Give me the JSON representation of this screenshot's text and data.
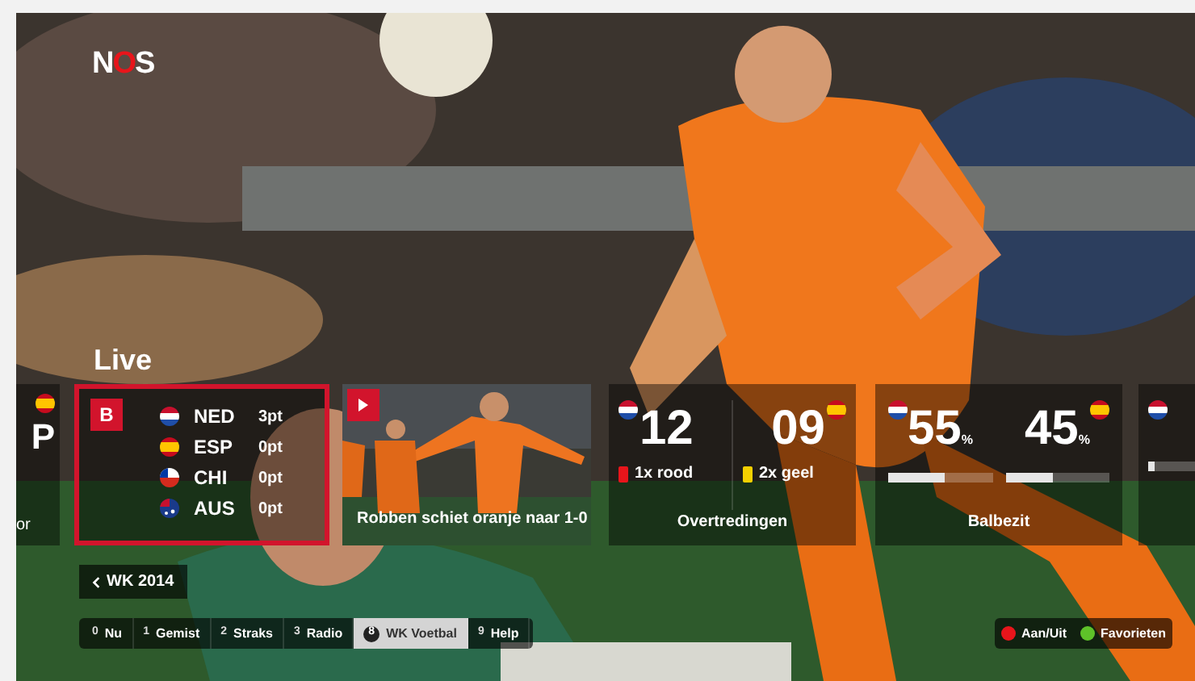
{
  "logo": "NOS",
  "section_title": "Live",
  "cards": [
    {
      "kind": "partial",
      "selected": false,
      "flag": {
        "kind": "es"
      },
      "big": "P",
      "caption": "or"
    },
    {
      "kind": "group",
      "selected": true,
      "badge": "B",
      "teams": [
        {
          "flag": {
            "kind": "nl"
          },
          "code": "NED",
          "points": "3pt"
        },
        {
          "flag": {
            "kind": "es"
          },
          "code": "ESP",
          "points": "0pt"
        },
        {
          "flag": {
            "kind": "cl"
          },
          "code": "CHI",
          "points": "0pt"
        },
        {
          "flag": {
            "kind": "au"
          },
          "code": "AUS",
          "points": "0pt"
        }
      ]
    },
    {
      "kind": "video",
      "selected": false,
      "caption": "Robben schiet oranje naar 1-0"
    },
    {
      "kind": "fouls",
      "selected": false,
      "title": "Overtredingen",
      "sides": [
        {
          "flag": {
            "kind": "nl"
          },
          "value": "12",
          "note": "1x rood",
          "color": "#e8151b"
        },
        {
          "flag": {
            "kind": "es"
          },
          "value": "09",
          "note": "2x geel",
          "color": "#f5d000"
        }
      ]
    },
    {
      "kind": "possession",
      "selected": false,
      "title": "Balbezit",
      "sides": [
        {
          "flag": {
            "kind": "nl"
          },
          "value": "55",
          "unit": "%",
          "level": 0.55
        },
        {
          "flag": {
            "kind": "es"
          },
          "value": "45",
          "unit": "%",
          "level": 0.45
        }
      ]
    },
    {
      "kind": "partial_right",
      "selected": false,
      "flag": {
        "kind": "nl"
      },
      "level": 0.15
    }
  ],
  "back_button": {
    "label": "WK 2014"
  },
  "nav": [
    {
      "key": "0",
      "label": "Nu",
      "selected": false
    },
    {
      "key": "1",
      "label": "Gemist",
      "selected": false
    },
    {
      "key": "2",
      "label": "Straks",
      "selected": false
    },
    {
      "key": "3",
      "label": "Radio",
      "selected": false
    },
    {
      "key": "8",
      "label": "WK Voetbal",
      "selected": true
    },
    {
      "key": "9",
      "label": "Help",
      "selected": false
    }
  ],
  "color_buttons": [
    {
      "label": "Aan/Uit",
      "color": "#e8151b"
    },
    {
      "label": "Favorieten",
      "color": "#5ec229"
    }
  ]
}
